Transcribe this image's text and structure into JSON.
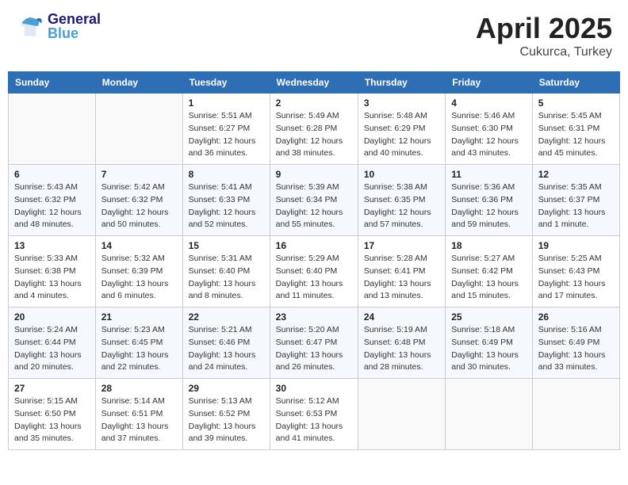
{
  "header": {
    "logo_general": "General",
    "logo_blue": "Blue",
    "month": "April 2025",
    "location": "Cukurca, Turkey"
  },
  "weekdays": [
    "Sunday",
    "Monday",
    "Tuesday",
    "Wednesday",
    "Thursday",
    "Friday",
    "Saturday"
  ],
  "weeks": [
    [
      {
        "day": "",
        "info": ""
      },
      {
        "day": "",
        "info": ""
      },
      {
        "day": "1",
        "info": "Sunrise: 5:51 AM\nSunset: 6:27 PM\nDaylight: 12 hours and 36 minutes."
      },
      {
        "day": "2",
        "info": "Sunrise: 5:49 AM\nSunset: 6:28 PM\nDaylight: 12 hours and 38 minutes."
      },
      {
        "day": "3",
        "info": "Sunrise: 5:48 AM\nSunset: 6:29 PM\nDaylight: 12 hours and 40 minutes."
      },
      {
        "day": "4",
        "info": "Sunrise: 5:46 AM\nSunset: 6:30 PM\nDaylight: 12 hours and 43 minutes."
      },
      {
        "day": "5",
        "info": "Sunrise: 5:45 AM\nSunset: 6:31 PM\nDaylight: 12 hours and 45 minutes."
      }
    ],
    [
      {
        "day": "6",
        "info": "Sunrise: 5:43 AM\nSunset: 6:32 PM\nDaylight: 12 hours and 48 minutes."
      },
      {
        "day": "7",
        "info": "Sunrise: 5:42 AM\nSunset: 6:32 PM\nDaylight: 12 hours and 50 minutes."
      },
      {
        "day": "8",
        "info": "Sunrise: 5:41 AM\nSunset: 6:33 PM\nDaylight: 12 hours and 52 minutes."
      },
      {
        "day": "9",
        "info": "Sunrise: 5:39 AM\nSunset: 6:34 PM\nDaylight: 12 hours and 55 minutes."
      },
      {
        "day": "10",
        "info": "Sunrise: 5:38 AM\nSunset: 6:35 PM\nDaylight: 12 hours and 57 minutes."
      },
      {
        "day": "11",
        "info": "Sunrise: 5:36 AM\nSunset: 6:36 PM\nDaylight: 12 hours and 59 minutes."
      },
      {
        "day": "12",
        "info": "Sunrise: 5:35 AM\nSunset: 6:37 PM\nDaylight: 13 hours and 1 minute."
      }
    ],
    [
      {
        "day": "13",
        "info": "Sunrise: 5:33 AM\nSunset: 6:38 PM\nDaylight: 13 hours and 4 minutes."
      },
      {
        "day": "14",
        "info": "Sunrise: 5:32 AM\nSunset: 6:39 PM\nDaylight: 13 hours and 6 minutes."
      },
      {
        "day": "15",
        "info": "Sunrise: 5:31 AM\nSunset: 6:40 PM\nDaylight: 13 hours and 8 minutes."
      },
      {
        "day": "16",
        "info": "Sunrise: 5:29 AM\nSunset: 6:40 PM\nDaylight: 13 hours and 11 minutes."
      },
      {
        "day": "17",
        "info": "Sunrise: 5:28 AM\nSunset: 6:41 PM\nDaylight: 13 hours and 13 minutes."
      },
      {
        "day": "18",
        "info": "Sunrise: 5:27 AM\nSunset: 6:42 PM\nDaylight: 13 hours and 15 minutes."
      },
      {
        "day": "19",
        "info": "Sunrise: 5:25 AM\nSunset: 6:43 PM\nDaylight: 13 hours and 17 minutes."
      }
    ],
    [
      {
        "day": "20",
        "info": "Sunrise: 5:24 AM\nSunset: 6:44 PM\nDaylight: 13 hours and 20 minutes."
      },
      {
        "day": "21",
        "info": "Sunrise: 5:23 AM\nSunset: 6:45 PM\nDaylight: 13 hours and 22 minutes."
      },
      {
        "day": "22",
        "info": "Sunrise: 5:21 AM\nSunset: 6:46 PM\nDaylight: 13 hours and 24 minutes."
      },
      {
        "day": "23",
        "info": "Sunrise: 5:20 AM\nSunset: 6:47 PM\nDaylight: 13 hours and 26 minutes."
      },
      {
        "day": "24",
        "info": "Sunrise: 5:19 AM\nSunset: 6:48 PM\nDaylight: 13 hours and 28 minutes."
      },
      {
        "day": "25",
        "info": "Sunrise: 5:18 AM\nSunset: 6:49 PM\nDaylight: 13 hours and 30 minutes."
      },
      {
        "day": "26",
        "info": "Sunrise: 5:16 AM\nSunset: 6:49 PM\nDaylight: 13 hours and 33 minutes."
      }
    ],
    [
      {
        "day": "27",
        "info": "Sunrise: 5:15 AM\nSunset: 6:50 PM\nDaylight: 13 hours and 35 minutes."
      },
      {
        "day": "28",
        "info": "Sunrise: 5:14 AM\nSunset: 6:51 PM\nDaylight: 13 hours and 37 minutes."
      },
      {
        "day": "29",
        "info": "Sunrise: 5:13 AM\nSunset: 6:52 PM\nDaylight: 13 hours and 39 minutes."
      },
      {
        "day": "30",
        "info": "Sunrise: 5:12 AM\nSunset: 6:53 PM\nDaylight: 13 hours and 41 minutes."
      },
      {
        "day": "",
        "info": ""
      },
      {
        "day": "",
        "info": ""
      },
      {
        "day": "",
        "info": ""
      }
    ]
  ]
}
